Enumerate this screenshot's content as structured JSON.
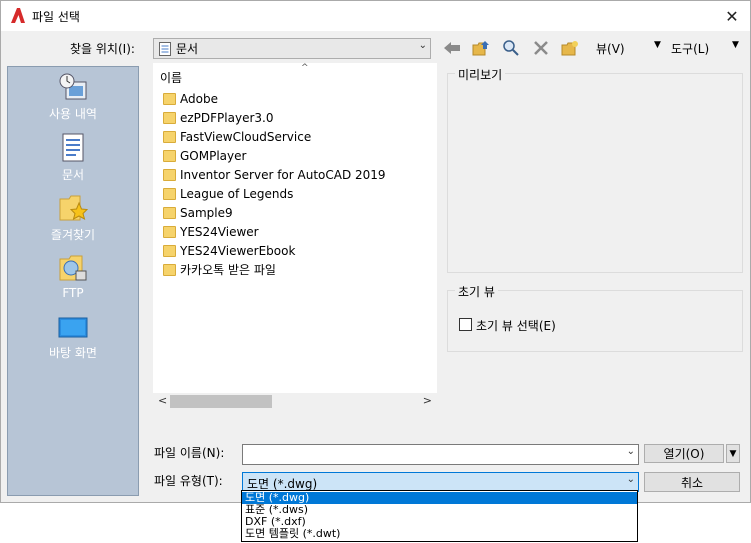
{
  "window": {
    "title": "파일 선택",
    "close_glyph": "✕"
  },
  "toolbar": {
    "lookin_label": "찾을 위치(I):",
    "lookin_value": "문서",
    "view_menu": "뷰(V)",
    "tools_menu": "도구(L)",
    "icons": [
      "back-arrow-icon",
      "up-folder-icon",
      "search-web-icon",
      "delete-icon",
      "new-folder-icon"
    ]
  },
  "places": [
    {
      "label": "사용 내역",
      "icon": "history-icon"
    },
    {
      "label": "문서",
      "icon": "documents-icon"
    },
    {
      "label": "즐겨찾기",
      "icon": "favorites-icon"
    },
    {
      "label": "FTP",
      "icon": "ftp-icon"
    },
    {
      "label": "바탕 화면",
      "icon": "desktop-icon"
    }
  ],
  "filelist": {
    "column_header": "이름",
    "items": [
      "Adobe",
      "ezPDFPlayer3.0",
      "FastViewCloudService",
      "GOMPlayer",
      "Inventor Server for AutoCAD 2019",
      "League of Legends",
      "Sample9",
      "YES24Viewer",
      "YES24ViewerEbook",
      "카카오톡 받은 파일"
    ]
  },
  "preview": {
    "title": "미리보기"
  },
  "initial_view": {
    "title": "초기 뷰",
    "checkbox_label": "초기 뷰 선택(E)",
    "checked": false
  },
  "filename": {
    "label": "파일 이름(N):",
    "value": ""
  },
  "filetype": {
    "label": "파일 유형(T):",
    "value": "도면 (*.dwg)",
    "options": [
      "도면 (*.dwg)",
      "표준 (*.dws)",
      "DXF (*.dxf)",
      "도면 템플릿 (*.dwt)"
    ],
    "selected_index": 0
  },
  "buttons": {
    "open": "열기(O)",
    "cancel": "취소"
  },
  "colors": {
    "accent": "#0078d7",
    "places_bg": "#b7c5d6",
    "folder": "#f6d36b"
  }
}
